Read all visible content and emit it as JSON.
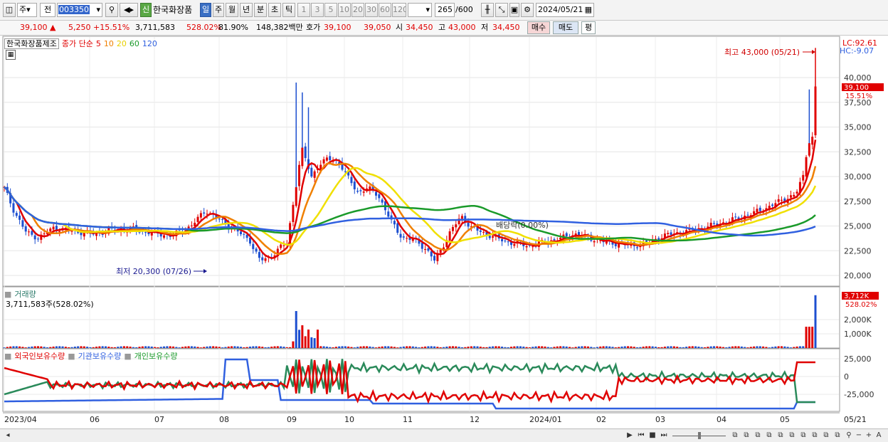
{
  "toolbar": {
    "type_sel": "주",
    "jeon_sel": "전",
    "code": "003350",
    "badge": "신",
    "name": "한국화장품",
    "periods": [
      "일",
      "주",
      "월",
      "년",
      "분",
      "초",
      "틱"
    ],
    "nums": [
      "1",
      "3",
      "5",
      "10",
      "20",
      "30",
      "60",
      "120"
    ],
    "count": "265",
    "count_total": "/600",
    "date": "2024/05/21"
  },
  "quote": {
    "price": "39,100",
    "change_arrow": "▲",
    "change": "5,250",
    "change_pct": "+15.51%",
    "volume": "3,711,583",
    "vol_ratio": "528.02%",
    "turnover": "81.90%",
    "amount": "148,382백만",
    "hoga_label": "호가",
    "hoga_ask": "39,100",
    "hoga_bid": "39,050",
    "open_label": "시",
    "open": "34,450",
    "high_label": "고",
    "high": "43,000",
    "low_label": "저",
    "low": "34,450",
    "buy_btn": "매수",
    "sell_btn": "매도",
    "eval_btn": "평"
  },
  "price_panel": {
    "stock_label": "한국화장품제조",
    "ma_label": "종가 단순",
    "ma_periods": [
      {
        "p": "5",
        "color": "#e00000"
      },
      {
        "p": "10",
        "color": "#f08000"
      },
      {
        "p": "20",
        "color": "#f0e000"
      },
      {
        "p": "60",
        "color": "#1a9a2a"
      },
      {
        "p": "120",
        "color": "#3060e0"
      }
    ],
    "lc": "LC:92.61",
    "hc": "HC:-9.07",
    "max_note": "최고 43,000 (05/21)",
    "min_note": "최저 20,300 (07/26)",
    "dividend_note": "배당락(0.00%)",
    "last_price_tag": "39,100",
    "last_pct_tag": "15.51%",
    "y_ticks": [
      "40,000",
      "37,500",
      "35,000",
      "32,500",
      "30,000",
      "27,500",
      "25,000",
      "22,500",
      "20,000"
    ]
  },
  "volume_panel": {
    "title": "거래량",
    "value": "3,711,583주(528.02%)",
    "tag": "3,712K",
    "tag_pct": "528.02%",
    "y_ticks": [
      "2,000K",
      "1,000K"
    ]
  },
  "holding_panel": {
    "foreign_label": "외국인보유수량",
    "inst_label": "기관보유수량",
    "indiv_label": "개인보유수량",
    "y_ticks": [
      "25,000",
      "0",
      "-25,000"
    ]
  },
  "x_axis": [
    "2023/04",
    "06",
    "07",
    "08",
    "09",
    "10",
    "11",
    "12",
    "2024/01",
    "02",
    "03",
    "04",
    "05",
    "05/21"
  ],
  "chart_data": {
    "type": "candlestick",
    "x": [
      "2023/04",
      "06",
      "07",
      "08",
      "09",
      "10",
      "11",
      "12",
      "2024/01",
      "02",
      "03",
      "04",
      "05",
      "05/21"
    ],
    "close_approx": [
      26500,
      24500,
      24800,
      23800,
      30500,
      25500,
      23500,
      23000,
      23400,
      23200,
      23800,
      26000,
      28000,
      39100
    ],
    "ma": [
      "5",
      "10",
      "20",
      "60",
      "120"
    ],
    "high": 43000,
    "low": 20300,
    "ylim": [
      19500,
      43000
    ]
  }
}
